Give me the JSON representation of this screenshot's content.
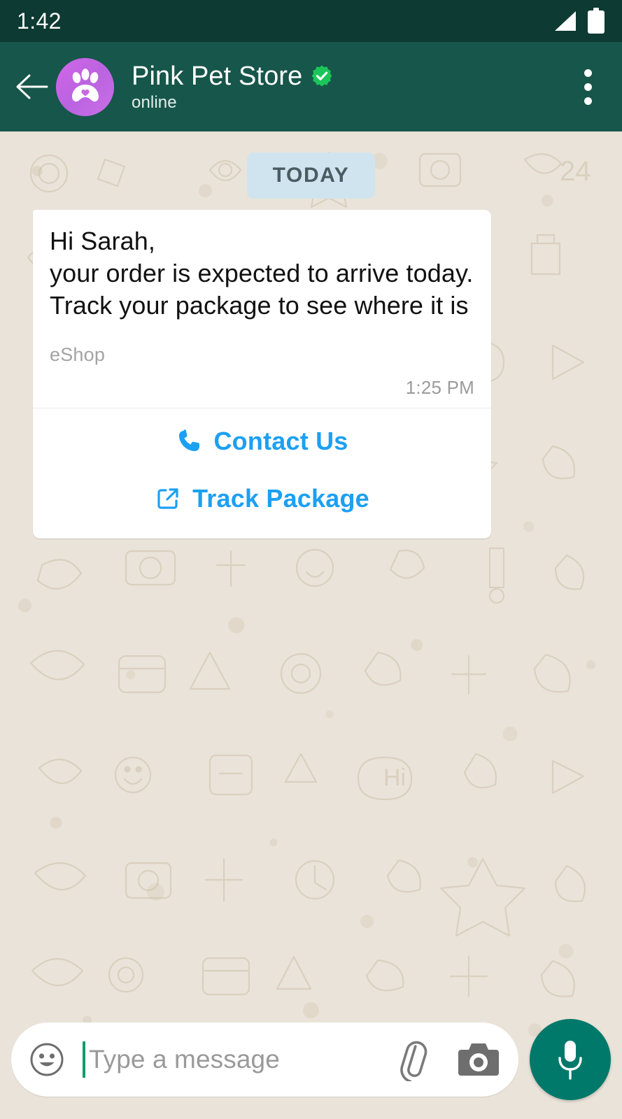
{
  "status_bar": {
    "clock": "1:42",
    "icons": [
      "signal-icon",
      "battery-icon"
    ],
    "background_color": "#0D3A32"
  },
  "header": {
    "back_icon": "back-arrow-icon",
    "avatar_icon": "paw-heart-icon",
    "avatar_gradient_from": "#D267E8",
    "avatar_gradient_to": "#BB63E0",
    "contact_name": "Pink Pet Store",
    "verified_badge_icon": "verified-check-icon",
    "verified_badge_color": "#1BC55A",
    "presence": "online",
    "overflow_icon": "more-vertical-icon",
    "background_color": "#17564A"
  },
  "conversation": {
    "background_color": "#EAE3D9",
    "date_divider": {
      "label": "TODAY",
      "background_color": "#CFE4EF",
      "text_color": "#4A5B62"
    },
    "message": {
      "text": "Hi Sarah,\nyour order is expected to arrive today. Track your package to see where it is",
      "sender_footer": "eShop",
      "time": "1:25 PM",
      "bubble_color": "#FFFFFF",
      "actions": [
        {
          "label": "Contact Us",
          "icon": "phone-icon",
          "color": "#1CA0F2"
        },
        {
          "label": "Track Package",
          "icon": "external-link-icon",
          "color": "#1CA0F2"
        }
      ]
    }
  },
  "composer": {
    "emoji_icon": "emoji-smiley-icon",
    "placeholder": "Type a message",
    "value": "",
    "attach_icon": "paperclip-icon",
    "camera_icon": "camera-icon",
    "mic_icon": "microphone-icon",
    "mic_button_color": "#00796B"
  }
}
